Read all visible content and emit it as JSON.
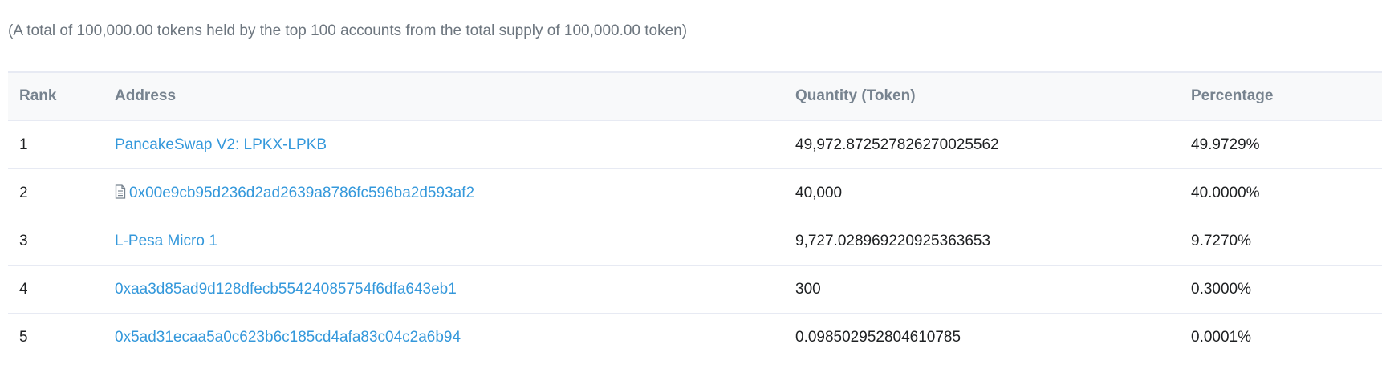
{
  "summary": "(A total of 100,000.00 tokens held by the top 100 accounts from the total supply of 100,000.00 token)",
  "table": {
    "headers": {
      "rank": "Rank",
      "address": "Address",
      "quantity": "Quantity (Token)",
      "percentage": "Percentage"
    },
    "rows": [
      {
        "rank": "1",
        "address": "PancakeSwap V2: LPKX-LPKB",
        "is_contract": false,
        "quantity": "49,972.872527826270025562",
        "percentage": "49.9729%"
      },
      {
        "rank": "2",
        "address": "0x00e9cb95d236d2ad2639a8786fc596ba2d593af2",
        "is_contract": true,
        "icon": "file-contract-icon",
        "quantity": "40,000",
        "percentage": "40.0000%"
      },
      {
        "rank": "3",
        "address": "L-Pesa Micro 1",
        "is_contract": false,
        "quantity": "9,727.028969220925363653",
        "percentage": "9.7270%"
      },
      {
        "rank": "4",
        "address": "0xaa3d85ad9d128dfecb55424085754f6dfa643eb1",
        "is_contract": false,
        "quantity": "300",
        "percentage": "0.3000%"
      },
      {
        "rank": "5",
        "address": "0x5ad31ecaa5a0c623b6c185cd4afa83c04c2a6b94",
        "is_contract": false,
        "quantity": "0.098502952804610785",
        "percentage": "0.0001%"
      }
    ]
  },
  "colors": {
    "link": "#3498db",
    "muted": "#77838f",
    "text": "#1e2022",
    "header_bg": "#f8f9fa",
    "border": "#e7eaf3"
  }
}
